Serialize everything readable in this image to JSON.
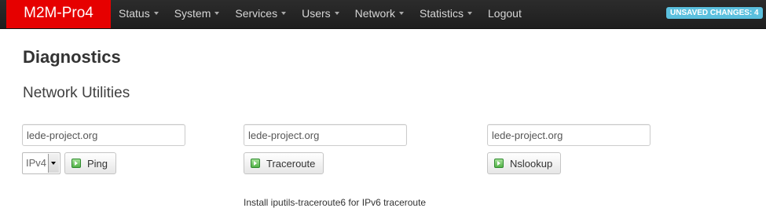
{
  "header": {
    "brand": "M2M-Pro4",
    "nav": [
      {
        "label": "Status",
        "dropdown": true
      },
      {
        "label": "System",
        "dropdown": true
      },
      {
        "label": "Services",
        "dropdown": true
      },
      {
        "label": "Users",
        "dropdown": true
      },
      {
        "label": "Network",
        "dropdown": true
      },
      {
        "label": "Statistics",
        "dropdown": true
      },
      {
        "label": "Logout",
        "dropdown": false
      }
    ],
    "unsaved_changes": "UNSAVED CHANGES: 4",
    "colors": {
      "brand_bg": "#e60000",
      "bar_bg": "#222222",
      "badge_bg": "#5bc0de"
    }
  },
  "main": {
    "title": "Diagnostics",
    "section_title": "Network Utilities",
    "ping": {
      "host_value": "lede-project.org",
      "protocol_selected": "IPv4",
      "button_label": "Ping",
      "button_icon": "play-icon"
    },
    "traceroute": {
      "host_value": "lede-project.org",
      "button_label": "Traceroute",
      "button_icon": "play-icon",
      "note": "Install iputils-traceroute6 for IPv6 traceroute"
    },
    "nslookup": {
      "host_value": "lede-project.org",
      "button_label": "Nslookup",
      "button_icon": "play-icon"
    }
  }
}
